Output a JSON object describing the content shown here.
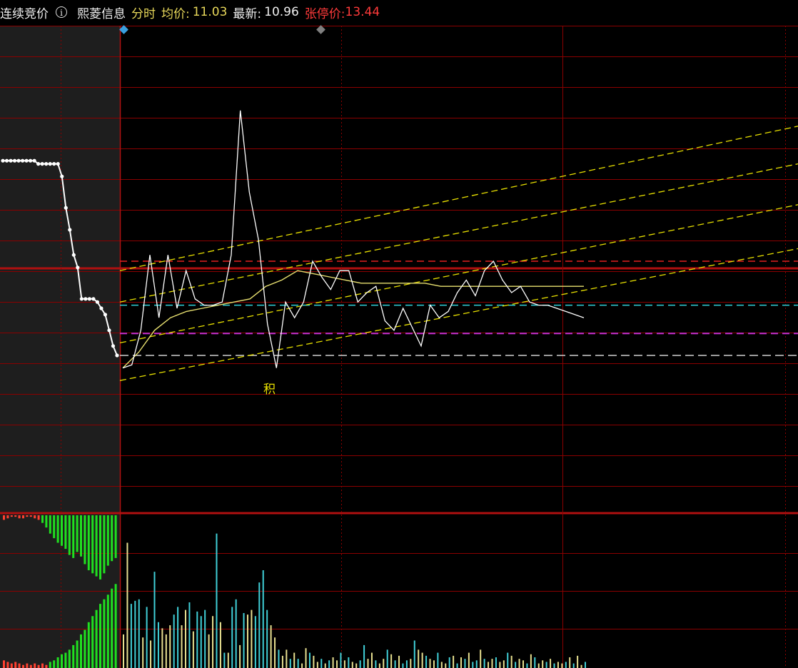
{
  "header": {
    "mode_label": "连续竞价",
    "info_icon": "info-circle-icon",
    "stock_name": "熙菱信息",
    "view_label": "分时",
    "avg_label": "均价:",
    "avg_value": "11.03",
    "last_label": "最新:",
    "last_value": "10.96",
    "limit_label": "张停价:",
    "limit_value": "13.44"
  },
  "colors": {
    "background": "#000000",
    "grid": "#8b0000",
    "pre_market_bg": "#1e1e1e",
    "price_line": "#ffffff",
    "avg_line": "#e8e070",
    "channel": "#e8e000",
    "cyan_ref": "#30d0d8",
    "magenta_ref": "#c030d0",
    "red_ref": "#e02020",
    "white_ref": "#d0d0d0",
    "vol_up": "#e8e090",
    "vol_down": "#40d0d8",
    "auction_buy": "#20e020",
    "auction_sell": "#ff4030"
  },
  "markers": {
    "start_marker_icon": "diamond-blue-icon",
    "mid_marker_icon": "diamond-gray-icon",
    "signal_text": "积"
  },
  "chart_data": {
    "type": "line",
    "title": "",
    "xlabel": "",
    "ylabel": "",
    "y_axis_labels_visible": false,
    "grid": true,
    "legend": "none",
    "ylim": [
      10.4,
      11.95
    ],
    "reference_lines": {
      "red_dashed": 11.2,
      "cyan_dashed": 11.06,
      "magenta_dashed": 10.97,
      "white_dashed": 10.9
    },
    "channel_lines": [
      {
        "x_start": 0,
        "y_start": 10.82,
        "x_end": 1.0,
        "y_end": 11.24
      },
      {
        "x_start": 0,
        "y_start": 10.94,
        "x_end": 1.0,
        "y_end": 11.38
      },
      {
        "x_start": 0,
        "y_start": 11.07,
        "x_end": 1.0,
        "y_end": 11.51
      },
      {
        "x_start": 0,
        "y_start": 11.17,
        "x_end": 1.0,
        "y_end": 11.63
      }
    ],
    "pre_market": {
      "price": [
        11.52,
        11.52,
        11.52,
        11.52,
        11.52,
        11.52,
        11.52,
        11.52,
        11.52,
        11.51,
        11.51,
        11.51,
        11.51,
        11.51,
        11.51,
        11.47,
        11.37,
        11.3,
        11.22,
        11.18,
        11.08,
        11.08,
        11.08,
        11.08,
        11.07,
        11.05,
        11.03,
        10.98,
        10.93,
        10.9
      ],
      "volume": [
        0.05,
        0.04,
        0.03,
        0.04,
        0.03,
        0.02,
        0.03,
        0.02,
        0.03,
        0.02,
        0.03,
        0.02,
        0.04,
        0.05,
        0.07,
        0.09,
        0.1,
        0.12,
        0.15,
        0.18,
        0.22,
        0.25,
        0.3,
        0.34,
        0.38,
        0.42,
        0.45,
        0.48,
        0.52,
        0.55
      ],
      "volume_buy_top": [
        0.03,
        0.02,
        0.01,
        0.01,
        0.02,
        0.02,
        0.01,
        0.01,
        0.02,
        0.03,
        0.05,
        0.08,
        0.12,
        0.15,
        0.18,
        0.2,
        0.22,
        0.26,
        0.28,
        0.24,
        0.27,
        0.32,
        0.36,
        0.38,
        0.4,
        0.42,
        0.38,
        0.33,
        0.3,
        0.28
      ]
    },
    "series": [
      {
        "values": [
          10.86,
          10.87,
          10.98,
          11.22,
          11.02,
          11.22,
          11.05,
          11.17,
          11.08,
          11.06,
          11.06,
          11.07,
          11.22,
          11.68,
          11.42,
          11.27,
          11.0,
          10.86,
          11.07,
          11.02,
          11.07,
          11.2,
          11.15,
          11.11,
          11.17,
          11.17,
          11.07,
          11.1,
          11.12,
          11.01,
          10.98,
          11.05,
          10.99,
          10.93,
          11.06,
          11.02,
          11.04,
          11.1,
          11.14,
          11.09,
          11.17,
          11.2,
          11.14,
          11.1,
          11.12,
          11.07,
          11.06,
          11.06,
          11.05,
          11.04,
          11.03,
          11.02
        ]
      },
      {
        "values": [
          10.86,
          10.91,
          10.98,
          11.02,
          11.04,
          11.05,
          11.06,
          11.07,
          11.08,
          11.12,
          11.14,
          11.17,
          11.16,
          11.15,
          11.14,
          11.13,
          11.13,
          11.13,
          11.13,
          11.13,
          11.12,
          11.12,
          11.12,
          11.12,
          11.12,
          11.12,
          11.12,
          11.12,
          11.12,
          11.12
        ]
      }
    ],
    "volume": {
      "values": [
        0.22,
        0.82,
        0.42,
        0.44,
        0.45,
        0.2,
        0.4,
        0.18,
        0.63,
        0.3,
        0.26,
        0.22,
        0.28,
        0.35,
        0.4,
        0.28,
        0.38,
        0.43,
        0.24,
        0.37,
        0.34,
        0.38,
        0.22,
        0.34,
        0.88,
        0.3,
        0.1,
        0.1,
        0.4,
        0.45,
        0.15,
        0.36,
        0.35,
        0.38,
        0.34,
        0.56,
        0.64,
        0.38,
        0.28,
        0.2,
        0.12,
        0.08,
        0.12,
        0.06,
        0.1,
        0.06,
        0.03,
        0.13,
        0.1,
        0.08,
        0.04,
        0.06,
        0.03,
        0.05,
        0.07,
        0.05,
        0.1,
        0.05,
        0.07,
        0.04,
        0.03,
        0.05,
        0.15,
        0.06,
        0.1,
        0.05,
        0.03,
        0.06,
        0.12,
        0.09,
        0.05,
        0.08,
        0.03,
        0.05,
        0.06,
        0.18,
        0.12,
        0.1,
        0.08,
        0.06,
        0.05,
        0.1,
        0.04,
        0.03,
        0.07,
        0.08,
        0.03,
        0.07,
        0.06,
        0.1,
        0.04,
        0.05,
        0.12,
        0.06,
        0.04,
        0.06,
        0.07,
        0.04,
        0.05,
        0.1,
        0.08,
        0.04,
        0.06,
        0.05,
        0.03,
        0.09,
        0.07,
        0.03,
        0.05,
        0.04,
        0.06,
        0.03,
        0.04,
        0.03,
        0.04,
        0.07,
        0.03,
        0.08,
        0.02,
        0.04
      ],
      "up_flags": [
        1,
        1,
        0,
        0,
        0,
        1,
        0,
        1,
        0,
        0,
        1,
        1,
        1,
        0,
        0,
        1,
        1,
        0,
        1,
        0,
        0,
        0,
        1,
        1,
        0,
        1,
        0,
        1,
        0,
        0,
        1,
        0,
        1,
        1,
        0,
        0,
        0,
        0,
        1,
        1,
        0,
        1,
        1,
        0,
        1,
        0,
        1,
        1,
        0,
        1,
        1,
        0,
        1,
        0,
        1,
        1,
        0,
        1,
        0,
        1,
        1,
        0,
        0,
        1,
        1,
        0,
        1,
        1,
        0,
        1,
        0,
        1,
        0,
        0,
        1,
        0,
        1,
        1,
        0,
        1,
        1,
        0,
        1,
        1,
        0,
        1,
        0,
        1,
        0,
        1,
        0,
        0,
        1,
        0,
        1,
        1,
        0,
        1,
        1,
        0,
        1,
        0,
        1,
        1,
        0,
        1,
        0,
        1,
        1,
        0,
        1,
        0,
        1,
        1,
        0,
        1,
        0,
        1,
        1,
        0
      ]
    }
  }
}
